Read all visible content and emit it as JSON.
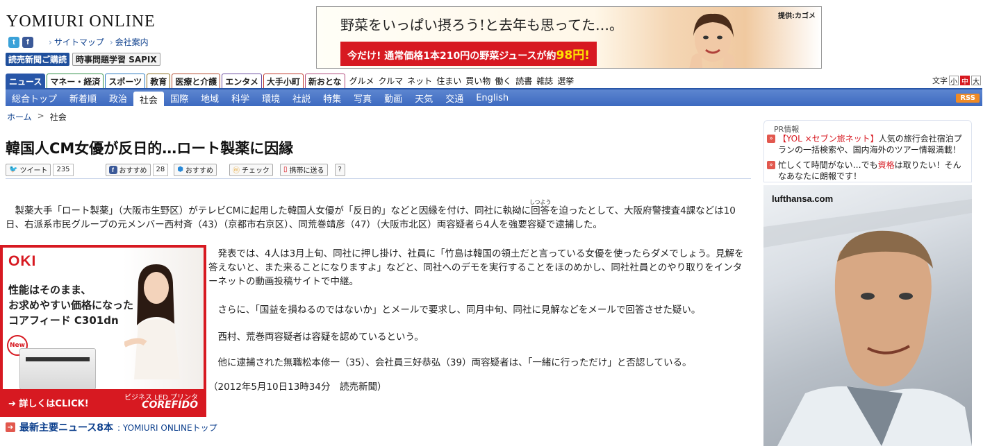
{
  "site": {
    "logo": "YOMIURI ONLINE",
    "links": [
      "サイトマップ",
      "会社案内"
    ],
    "promo_buttons": [
      "読売新聞ご購読",
      "時事問題学習 SAPIX"
    ]
  },
  "banner_ad": {
    "headline": "野菜をいっぱい摂ろう!と去年も思ってた…。",
    "offer_prefix": "今だけ! 通常価格1本210円の野菜ジュースが約",
    "offer_price": "98円!",
    "credit": "提供:カゴメ"
  },
  "category_nav": {
    "tabs": [
      "ニュース",
      "マネー・経済",
      "スポーツ",
      "教育",
      "医療と介護",
      "エンタメ",
      "大手小町",
      "新おとな"
    ],
    "tab_colors": [
      "#2856a8",
      "#2f8f46",
      "#2a7ac0",
      "#8a6d1f",
      "#b34a2e",
      "#6a4ca0",
      "#c0382b",
      "#b0487a"
    ],
    "plain": [
      "グルメ",
      "クルマ",
      "ネット",
      "住まい",
      "買い物",
      "働く",
      "読書",
      "雑誌",
      "選挙"
    ],
    "font_size_label": "文字",
    "font_sizes": [
      "小",
      "中",
      "大"
    ]
  },
  "sub_nav": {
    "items": [
      "総合トップ",
      "新着順",
      "政治",
      "社会",
      "国際",
      "地域",
      "科学",
      "環境",
      "社説",
      "特集",
      "写真",
      "動画",
      "天気",
      "交通",
      "English"
    ],
    "active": "社会",
    "rss": "RSS"
  },
  "breadcrumb": {
    "home": "ホーム",
    "sep": ">",
    "current": "社会"
  },
  "article": {
    "title": "韓国人CM女優が反日的…ロート製薬に因縁",
    "share": {
      "tweet": "ツイート",
      "tweet_count": "235",
      "fb_recommend": "おすすめ",
      "fb_count": "28",
      "recommend2": "おすすめ",
      "check": "チェック",
      "mobile": "携帯に送る",
      "help": "?"
    },
    "furigana": "しつよう",
    "paragraphs": [
      "　製薬大手「ロート製薬」（大阪市生野区）がテレビCMに起用した韓国人女優が「反日的」などと因縁を付け、同社に執拗に回答を迫ったとして、大阪府警捜査4課などは10日、右派系市民グループの元メンバー西村斉（43）（京都市右京区）、同荒巻靖彦（47）（大阪市北区）両容疑者ら4人を強要容疑で逮捕した。",
      "　発表では、4人は3月上旬、同社に押し掛け、社員に「竹島は韓国の領土だと言っている女優を使ったらダメでしょう。見解を答えないと、また来ることになりますよ」などと、同社へのデモを実行することをほのめかし、同社社員とのやり取りをインターネットの動画投稿サイトで中継。",
      "　さらに、「国益を損ねるのではないか」とメールで要求し、同月中旬、同社に見解などをメールで回答させた疑い。",
      "　西村、荒巻両容疑者は容疑を認めているという。",
      "　他に逮捕された無職松本修一（35）、会社員三好恭弘（39）両容疑者は、「一緒に行っただけ」と否認している。"
    ],
    "dateline": "（2012年5月10日13時34分　読売新聞）"
  },
  "oki_ad": {
    "brand": "OKI",
    "copy": [
      "性能はそのまま、",
      "お求めやすい価格になった",
      "コアフィード C301dn"
    ],
    "new_badge": "New",
    "cta": "➔ 詳しくはCLICK!",
    "sub": "ビジネス LED プリンタ",
    "product": "COREFIDO"
  },
  "more_news": {
    "title": "最新主要ニュース8本",
    "source": ": YOMIURI ONLINEトップ"
  },
  "pr": {
    "label": "PR情報",
    "items": [
      {
        "red": "【YOL ×セブン旅ネット】",
        "text": "人気の旅行会社宿泊プランの一括検索や、国内海外のツアー情報満載！"
      },
      {
        "pre": "忙しくて時間がない…でも",
        "red": "資格",
        "text": "は取りたい！そんなあなたに朗報です！"
      }
    ]
  },
  "side_ad": {
    "url": "lufthansa.com"
  }
}
